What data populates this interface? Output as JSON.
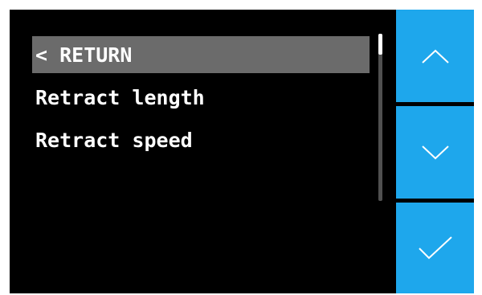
{
  "menu": {
    "items": [
      {
        "label": "< RETURN",
        "selected": true
      },
      {
        "label": "Retract length",
        "selected": false
      },
      {
        "label": "Retract speed",
        "selected": false
      }
    ]
  },
  "scrollbar": {
    "position_fraction": 0.0
  },
  "buttons": {
    "up": {
      "icon": "chevron-up-icon"
    },
    "down": {
      "icon": "chevron-down-icon"
    },
    "confirm": {
      "icon": "checkmark-icon"
    }
  },
  "colors": {
    "accent": "#1ea7ec",
    "highlight": "#6b6b6b",
    "background": "#000000",
    "text": "#ffffff"
  }
}
